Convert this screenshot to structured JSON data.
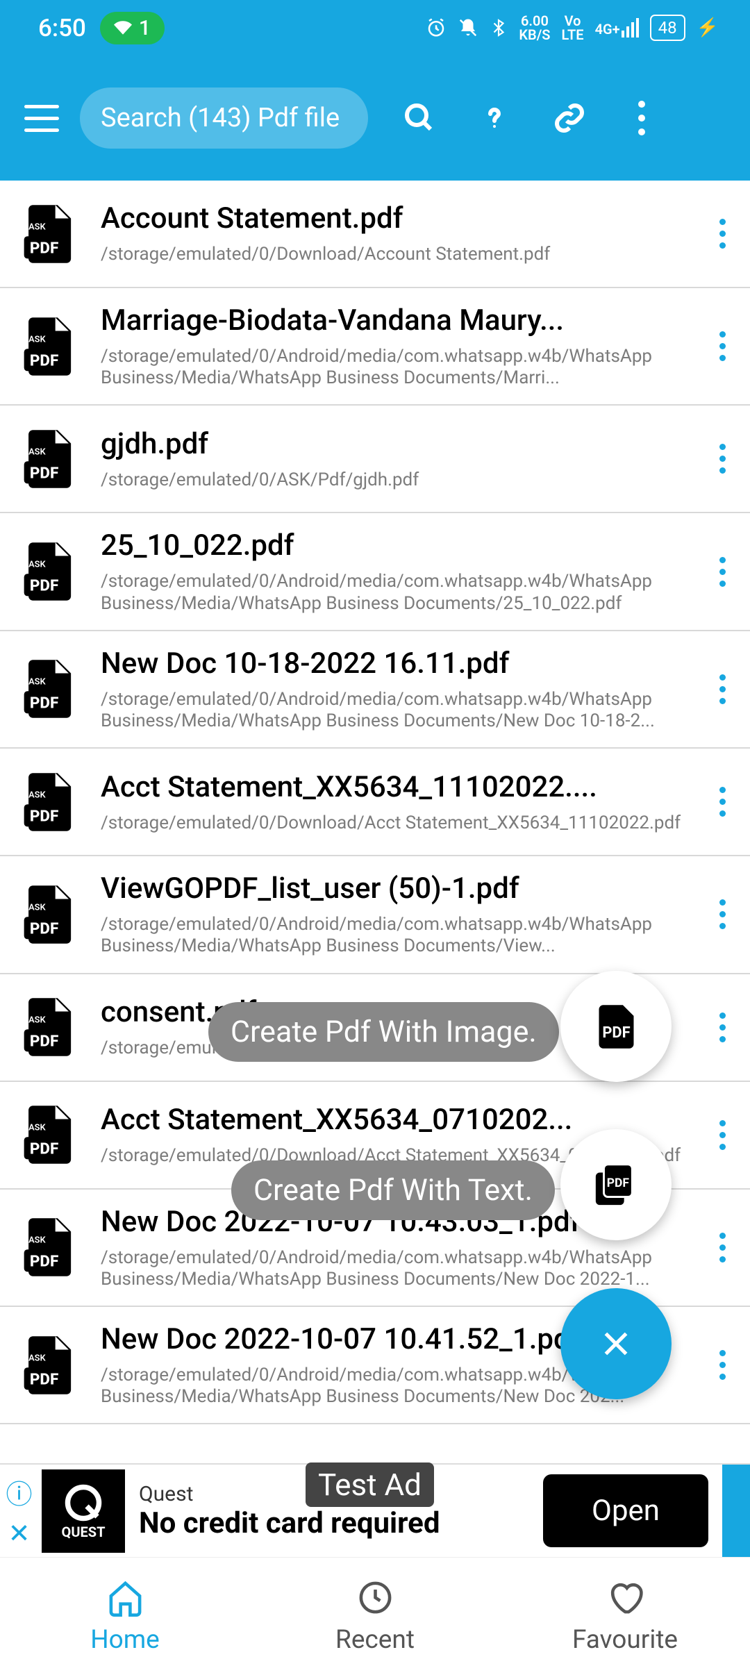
{
  "statusBar": {
    "time": "6:50",
    "wifiCount": "1",
    "kbs": "6.00",
    "kbsUnit": "KB/S",
    "volte": "Vo\nLTE",
    "net": "4G+",
    "battery": "48"
  },
  "appBar": {
    "searchPlaceholder": "Search (143) Pdf file"
  },
  "files": [
    {
      "name": "Account Statement.pdf",
      "path": "/storage/emulated/0/Download/Account Statement.pdf"
    },
    {
      "name": "Marriage-Biodata-Vandana Maury...",
      "path": "/storage/emulated/0/Android/media/com.whatsapp.w4b/WhatsApp Business/Media/WhatsApp Business Documents/Marri..."
    },
    {
      "name": "gjdh.pdf",
      "path": "/storage/emulated/0/ASK/Pdf/gjdh.pdf"
    },
    {
      "name": "25_10_022.pdf",
      "path": "/storage/emulated/0/Android/media/com.whatsapp.w4b/WhatsApp Business/Media/WhatsApp Business Documents/25_10_022.pdf"
    },
    {
      "name": "New Doc 10-18-2022 16.11.pdf",
      "path": "/storage/emulated/0/Android/media/com.whatsapp.w4b/WhatsApp Business/Media/WhatsApp Business Documents/New Doc 10-18-2..."
    },
    {
      "name": "Acct Statement_XX5634_11102022....",
      "path": "/storage/emulated/0/Download/Acct Statement_XX5634_11102022.pdf"
    },
    {
      "name": "ViewGOPDF_list_user (50)-1.pdf",
      "path": "/storage/emulated/0/Android/media/com.whatsapp.w4b/WhatsApp Business/Media/WhatsApp Business Documents/View..."
    },
    {
      "name": "consent.pdf",
      "path": "/storage/emulated/0/Download/consent.pdf"
    },
    {
      "name": "Acct Statement_XX5634_0710202...",
      "path": "/storage/emulated/0/Download/Acct Statement_XX5634_07102022.pdf"
    },
    {
      "name": "New Doc 2022-10-07 10.43.03_1.pdf",
      "path": "/storage/emulated/0/Android/media/com.whatsapp.w4b/WhatsApp Business/Media/WhatsApp Business Documents/New Doc 2022-1..."
    },
    {
      "name": "New Doc 2022-10-07 10.41.52_1.pdf",
      "path": "/storage/emulated/0/Android/media/com.whatsapp.w4b/WhatsApp Business/Media/WhatsApp Business Documents/New Doc 202..."
    }
  ],
  "fab": {
    "imageLabel": "Create Pdf With Image.",
    "textLabel": "Create Pdf With Text."
  },
  "ad": {
    "testLabel": "Test Ad",
    "brand": "Quest",
    "headline": "No credit card required",
    "cta": "Open",
    "logoText": "QUEST"
  },
  "nav": {
    "home": "Home",
    "recent": "Recent",
    "favourite": "Favourite"
  }
}
